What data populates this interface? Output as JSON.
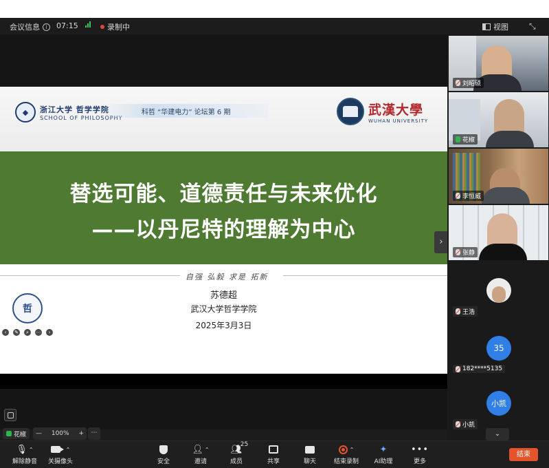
{
  "topbar": {
    "meeting_info": "会议信息",
    "time": "07:15",
    "recording": "录制中",
    "view": "视图"
  },
  "slide": {
    "zju_cn": "浙江大学 哲学学院",
    "zju_en": "SCHOOL OF PHILOSOPHY",
    "forum": "科哲 “华建电力” 论坛第 6 期",
    "whu_cn": "武漢大學",
    "whu_en": "WUHAN UNIVERSITY",
    "title_line1": "替选可能、道德责任与未来优化",
    "title_line2": "——以丹尼特的理解为中心",
    "motto": "自强 弘毅 求是 拓新",
    "author": "苏德超",
    "affiliation": "武汉大学哲学学院",
    "date": "2025年3月3日"
  },
  "local": {
    "name": "花椒",
    "zoom": "100%"
  },
  "participants": [
    {
      "name": "刘昭硕",
      "type": "video"
    },
    {
      "name": "花椒",
      "type": "video"
    },
    {
      "name": "李恒威",
      "type": "video"
    },
    {
      "name": "张静",
      "type": "video"
    },
    {
      "name": "王浩",
      "type": "photo"
    },
    {
      "name": "182****5135",
      "type": "avatar",
      "initials": "35"
    },
    {
      "name": "小凯",
      "type": "avatar",
      "initials": "小凯"
    }
  ],
  "toolbar": {
    "unmute": "解除静音",
    "stop_video": "关摄像头",
    "security": "安全",
    "invite": "邀请",
    "members": "成员",
    "members_count": "25",
    "share": "共享",
    "chat": "聊天",
    "end_recording": "结束录制",
    "ai_assistant": "AI助理",
    "more": "更多",
    "end": "结束"
  },
  "colors": {
    "accent_green": "#4e7a32",
    "end_button": "#e5532a",
    "avatar_blue": "#2f7fe6",
    "active_speaker": "#38b84a"
  }
}
